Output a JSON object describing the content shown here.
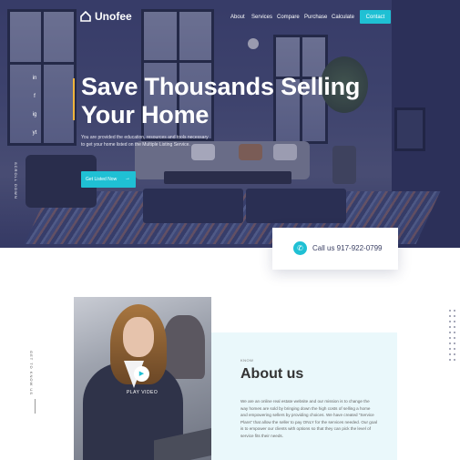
{
  "brand": {
    "name": "Unofee",
    "accent": "#1fc0d4",
    "highlight": "#f0b43c"
  },
  "nav": {
    "items": [
      "About",
      "Services",
      "Compare",
      "Purchase",
      "Calculate"
    ],
    "contact_label": "Contact"
  },
  "socials": [
    "in",
    "f",
    "ig",
    "yt"
  ],
  "hero": {
    "side_label": "SCROLL DOWN",
    "headline_line1": "Save Thousands Selling",
    "headline_line2": "Your Home",
    "subtext": "You are provided the education, resources and tools necessary to get your home listed on the Multiple Listing Service.",
    "cta_label": "Get Listed Now",
    "cta_arrow": "→"
  },
  "call": {
    "icon": "phone-icon",
    "text": "Call us 917-922-0799"
  },
  "about": {
    "side_label": "GET TO KNOW US",
    "play_icon": "play-icon",
    "play_label": "PLAY VIDEO",
    "kicker": "KNOW",
    "title": "About us",
    "text": "We are an online real estate website and our mission is to change the way homes are sold by bringing down the high costs of selling a home and empowering sellers by providing choices. We have created “Service Plans” that allow the seller to pay ONLY for the services needed. Our goal is to empower our clients with options so that they can pick the level of service fits their needs."
  }
}
